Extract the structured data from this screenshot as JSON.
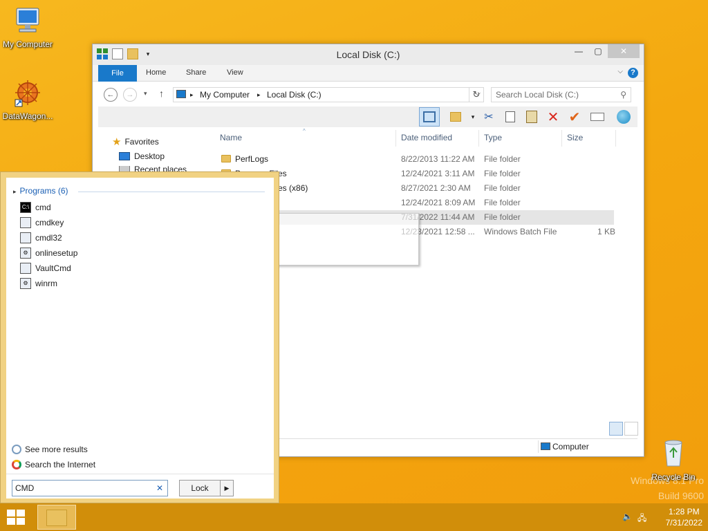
{
  "desktop": {
    "icons": [
      {
        "label": "My Computer",
        "icon": "computer-icon"
      },
      {
        "label": "DataWagon...",
        "icon": "datawagon-icon"
      },
      {
        "label": "Recycle Bin",
        "icon": "recycle-bin-icon"
      }
    ],
    "watermark_line1": "Windows 8.1 Pro",
    "watermark_line2": "Build 9600"
  },
  "explorer": {
    "title": "Local Disk (C:)",
    "ribbon_tabs": [
      "File",
      "Home",
      "Share",
      "View"
    ],
    "breadcrumb": [
      "My Computer",
      "Local Disk (C:)"
    ],
    "search_placeholder": "Search Local Disk (C:)",
    "nav_pane": {
      "favorites": "Favorites",
      "items": [
        "Desktop",
        "Recent places"
      ]
    },
    "columns": [
      "Name",
      "Date modified",
      "Type",
      "Size"
    ],
    "rows": [
      {
        "name": "PerfLogs",
        "date": "8/22/2013 11:22 AM",
        "type": "File folder",
        "size": ""
      },
      {
        "name": "Program Files",
        "date": "12/24/2021 3:11 AM",
        "type": "File folder",
        "size": ""
      },
      {
        "name": "Program Files (x86)",
        "date": "8/27/2021 2:30 AM",
        "type": "File folder",
        "size": ""
      },
      {
        "name": "",
        "date": "12/24/2021 8:09 AM",
        "type": "File folder",
        "size": ""
      },
      {
        "name": "",
        "date": "7/31/2022 11:44 AM",
        "type": "File folder",
        "size": ""
      },
      {
        "name": "",
        "date": "12/23/2021 12:58 ...",
        "type": "Windows Batch File",
        "size": "1 KB"
      }
    ],
    "status_location": "Computer"
  },
  "start_search": {
    "programs_header": "Programs (6)",
    "programs": [
      {
        "label": "cmd",
        "icon": "cmd-icon"
      },
      {
        "label": "cmdkey",
        "icon": "app-icon"
      },
      {
        "label": "cmdl32",
        "icon": "app-icon"
      },
      {
        "label": "onlinesetup",
        "icon": "gear-icon"
      },
      {
        "label": "VaultCmd",
        "icon": "app-icon"
      },
      {
        "label": "winrm",
        "icon": "gear-icon"
      }
    ],
    "see_more": "See more results",
    "search_internet": "Search the Internet",
    "query": "CMD",
    "lock_label": "Lock"
  },
  "taskbar": {
    "time": "1:28 PM",
    "date": "7/31/2022"
  },
  "colors": {
    "desktop": "#f5ac12",
    "accent": "#1979ca",
    "taskbar": "#cd8c0a"
  }
}
